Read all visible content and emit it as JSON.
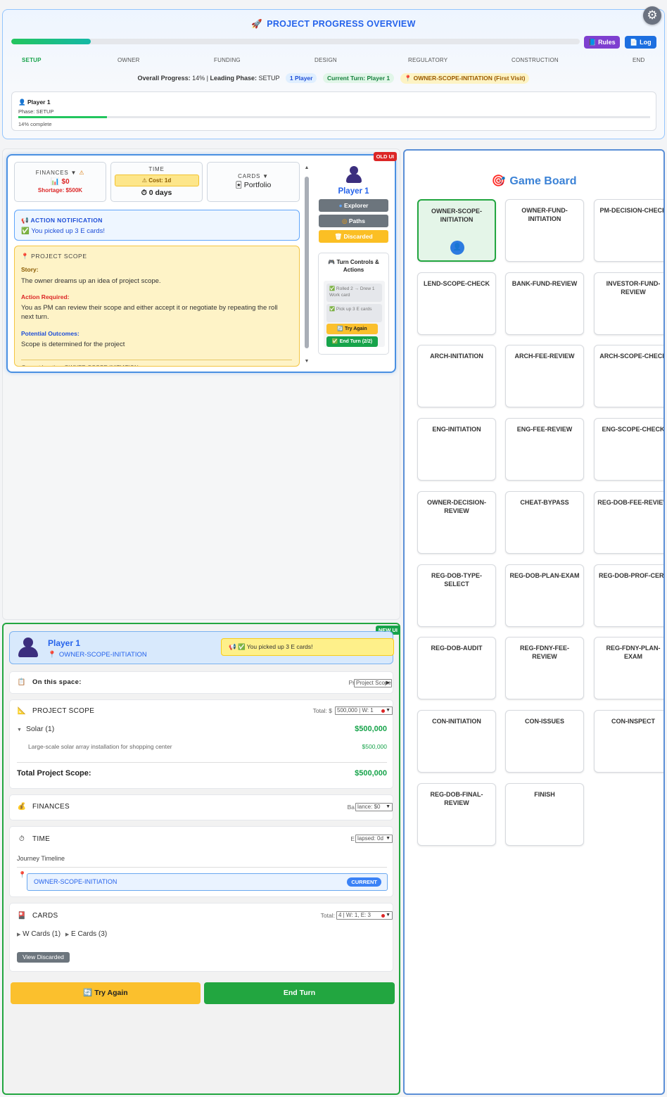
{
  "overview": {
    "title": "PROJECT PROGRESS OVERVIEW",
    "progress_fraction": 0.14,
    "rules_label": "📘 Rules",
    "log_label": "📄 Log",
    "phases": [
      "SETUP",
      "OWNER",
      "FUNDING",
      "DESIGN",
      "REGULATORY",
      "CONSTRUCTION",
      "END"
    ],
    "active_phase": "SETUP",
    "overall_label": "Overall Progress:",
    "overall_value": "14%",
    "leading_label": "Leading Phase:",
    "leading_value": "SETUP",
    "players_pill": "1 Player",
    "turn_pill": "Current Turn: Player 1",
    "location_pill": "OWNER-SCOPE-INITIATION (First Visit)",
    "player_card": {
      "name": "Player 1",
      "phase": "Phase: SETUP",
      "progress_fraction": 0.14,
      "progress_text": "14% complete"
    }
  },
  "old_ui": {
    "tag": "OLD UI",
    "finances": {
      "label": "FINANCES ▼",
      "money": "$0",
      "shortage": "Shortage: $500K"
    },
    "time": {
      "label": "TIME",
      "cost": "Cost: 1d",
      "days": "0 days"
    },
    "cards": {
      "label": "CARDS ▼",
      "value": "Portfolio"
    },
    "notification": {
      "title": "ACTION NOTIFICATION",
      "message": "You picked up 3 E cards!"
    },
    "scope": {
      "title": "PROJECT SCOPE",
      "story_label": "Story:",
      "story": "The owner dreams up an idea of project scope.",
      "action_label": "Action Required:",
      "action": "You as PM can review their scope and either accept it or negotiate by repeating the roll next turn.",
      "outcomes_label": "Potential Outcomes:",
      "outcomes": "Scope is determined for the project",
      "location": "Current location: OWNER-SCOPE-INITIATION"
    },
    "side": {
      "player_name": "Player 1",
      "explorer": "Explorer",
      "paths": "Paths",
      "discarded": "Discarded",
      "turn_title": "Turn Controls & Actions",
      "rolled": "Rolled 2 → Drew 1 Work card",
      "pickup": "Pick up 3 E cards",
      "try_again": "Try Again",
      "end_turn": "End Turn (2/2)"
    }
  },
  "new_ui": {
    "tag": "NEW UI",
    "player_name": "Player 1",
    "location": "OWNER-SCOPE-INITIATION",
    "notification": "You picked up 3 E cards!",
    "on_space_label": "On this space:",
    "on_space_dropdown": "Project Scope",
    "scope": {
      "title": "PROJECT SCOPE",
      "total_prefix": "Total: $",
      "total_dropdown": "500,000 | W: 1",
      "item_name": "Solar (1)",
      "item_amount": "$500,000",
      "item_desc": "Large-scale solar array installation for shopping center",
      "item_desc_amount": "$500,000",
      "total_label": "Total Project Scope:",
      "total_amount": "$500,000"
    },
    "finances": {
      "title": "FINANCES",
      "dropdown_prefix": "Ba",
      "dropdown": "lance: $0"
    },
    "time": {
      "title": "TIME",
      "dropdown_prefix": "E",
      "dropdown": "lapsed: 0d",
      "journey_label": "Journey Timeline",
      "location": "OWNER-SCOPE-INITIATION",
      "current_badge": "CURRENT"
    },
    "cards": {
      "title": "CARDS",
      "total_prefix": "Total:",
      "dropdown": "4 | W: 1, E: 3",
      "w_cards": "W Cards (1)",
      "e_cards": "E Cards (3)",
      "view_discarded": "View Discarded"
    },
    "try_again": "Try Again",
    "end_turn": "End Turn"
  },
  "board": {
    "title": "Game Board",
    "spaces": [
      "OWNER-SCOPE-INITIATION",
      "OWNER-FUND-INITIATION",
      "PM-DECISION-CHECK",
      "LEND-SCOPE-CHECK",
      "BANK-FUND-REVIEW",
      "INVESTOR-FUND-REVIEW",
      "ARCH-INITIATION",
      "ARCH-FEE-REVIEW",
      "ARCH-SCOPE-CHECK",
      "ENG-INITIATION",
      "ENG-FEE-REVIEW",
      "ENG-SCOPE-CHECK",
      "OWNER-DECISION-REVIEW",
      "CHEAT-BYPASS",
      "REG-DOB-FEE-REVIEW",
      "REG-DOB-TYPE-SELECT",
      "REG-DOB-PLAN-EXAM",
      "REG-DOB-PROF-CERT",
      "REG-DOB-AUDIT",
      "REG-FDNY-FEE-REVIEW",
      "REG-FDNY-PLAN-EXAM",
      "CON-INITIATION",
      "CON-ISSUES",
      "CON-INSPECT",
      "REG-DOB-FINAL-REVIEW",
      "FINISH"
    ],
    "current_space": "OWNER-SCOPE-INITIATION"
  },
  "colors": {
    "accent_blue": "#2563eb",
    "success_green": "#22a640",
    "warning_yellow": "#fbc02d",
    "danger_red": "#dc2626"
  }
}
